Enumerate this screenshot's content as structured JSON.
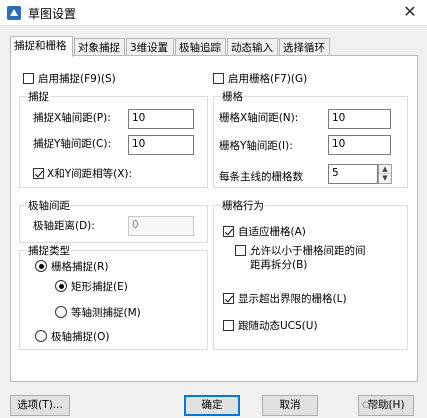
{
  "window": {
    "title": "草图设置"
  },
  "tabs": [
    "捕捉和栅格",
    "对象捕捉",
    "3维设置",
    "极轴追踪",
    "动态输入",
    "选择循环"
  ],
  "snap": {
    "enable_label": "启用捕捉(F9)(S)",
    "group_label": "捕捉",
    "x_label": "捕捉X轴间距(P):",
    "x_value": "10",
    "y_label": "捕捉Y轴间距(C):",
    "y_value": "10",
    "equal_label": "X和Y间距相等(X):"
  },
  "polar": {
    "group_label": "极轴间距",
    "distance_label": "极轴距离(D):",
    "distance_value": "0"
  },
  "snap_type": {
    "group_label": "捕捉类型",
    "grid_snap": "栅格捕捉(R)",
    "rect_snap": "矩形捕捉(E)",
    "iso_snap": "等轴测捕捉(M)",
    "polar_snap": "极轴捕捉(O)"
  },
  "grid": {
    "enable_label": "启用栅格(F7)(G)",
    "group_label": "栅格",
    "x_label": "栅格X轴间距(N):",
    "x_value": "10",
    "y_label": "栅格Y轴间距(I):",
    "y_value": "10",
    "major_label": "每条主线的栅格数",
    "major_value": "5"
  },
  "grid_behavior": {
    "group_label": "栅格行为",
    "adaptive": "自适应栅格(A)",
    "subdivide_line1": "允许以小于栅格间距的间",
    "subdivide_line2": "距再拆分(B)",
    "beyond_limits": "显示超出界限的栅格(L)",
    "follow_ucs": "跟随动态UCS(U)"
  },
  "buttons": {
    "options": "选项(T)...",
    "ok": "确定",
    "cancel": "取消",
    "help": "帮助(H)"
  },
  "watermark": "CAD吧"
}
